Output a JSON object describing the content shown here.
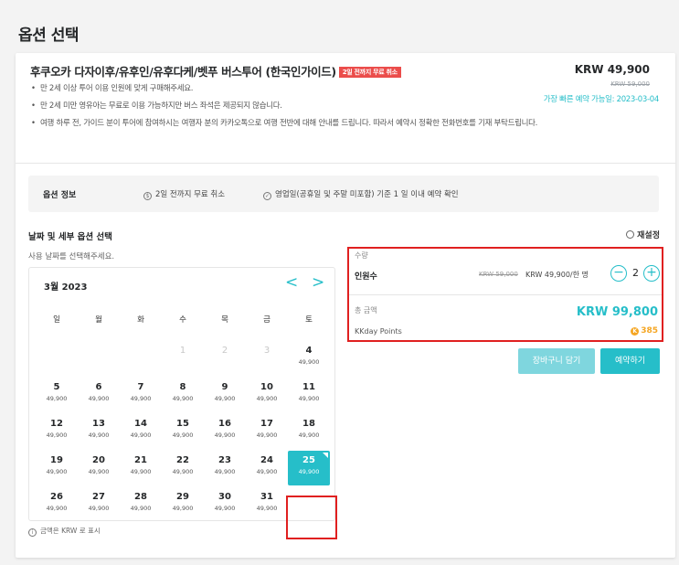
{
  "page": {
    "title": "옵션 선택"
  },
  "product": {
    "title": "후쿠오카 다자이후/유후인/유후다케/벳푸 버스투어 (한국인가이드)",
    "badge": "2일 전까지 무료 취소",
    "price": "KRW 49,900",
    "old_price": "KRW 59,000",
    "availability": "가장 빠른 예약 가능일: 2023-03-04",
    "notes": [
      "만 2세 이상 투어 이용 인원에 맞게 구매해주세요.",
      "만 2세 미만 영유아는 무료로 이용 가능하지만 버스 좌석은 제공되지 않습니다.",
      "여행 하루 전, 가이드 분이 투어에 참여하시는 여행자 분의 카카오톡으로 여행 전반에 대해 안내를 드립니다. 따라서 예약시 정확한 전화번호를 기재 부탁드립니다."
    ]
  },
  "option_info": {
    "label": "옵션 정보",
    "cancel": "2일 전까지 무료 취소",
    "confirm": "영업일(공휴일 및 주말 미포함) 기준 1 일 이내 예약 확인"
  },
  "date_section": {
    "title": "날짜 및 세부 옵션 선택",
    "subtitle": "사용 날짜를 선택해주세요.",
    "reset": "재설정",
    "footnote": "금액은 KRW 로 표시"
  },
  "calendar": {
    "month": "3월 2023",
    "prev": "<",
    "next": ">",
    "weekdays": [
      "일",
      "월",
      "화",
      "수",
      "목",
      "금",
      "토"
    ],
    "selected_day": "25",
    "days": [
      {
        "n": "1",
        "p": ""
      },
      {
        "n": "2",
        "p": ""
      },
      {
        "n": "3",
        "p": ""
      },
      {
        "n": "4",
        "p": "49,900"
      },
      {
        "n": "5",
        "p": "49,900"
      },
      {
        "n": "6",
        "p": "49,900"
      },
      {
        "n": "7",
        "p": "49,900"
      },
      {
        "n": "8",
        "p": "49,900"
      },
      {
        "n": "9",
        "p": "49,900"
      },
      {
        "n": "10",
        "p": "49,900"
      },
      {
        "n": "11",
        "p": "49,900"
      },
      {
        "n": "12",
        "p": "49,900"
      },
      {
        "n": "13",
        "p": "49,900"
      },
      {
        "n": "14",
        "p": "49,900"
      },
      {
        "n": "15",
        "p": "49,900"
      },
      {
        "n": "16",
        "p": "49,900"
      },
      {
        "n": "17",
        "p": "49,900"
      },
      {
        "n": "18",
        "p": "49,900"
      },
      {
        "n": "19",
        "p": "49,900"
      },
      {
        "n": "20",
        "p": "49,900"
      },
      {
        "n": "21",
        "p": "49,900"
      },
      {
        "n": "22",
        "p": "49,900"
      },
      {
        "n": "23",
        "p": "49,900"
      },
      {
        "n": "24",
        "p": "49,900"
      },
      {
        "n": "25",
        "p": "49,900"
      },
      {
        "n": "26",
        "p": "49,900"
      },
      {
        "n": "27",
        "p": "49,900"
      },
      {
        "n": "28",
        "p": "49,900"
      },
      {
        "n": "29",
        "p": "49,900"
      },
      {
        "n": "30",
        "p": "49,900"
      },
      {
        "n": "31",
        "p": "49,900"
      }
    ]
  },
  "quantity": {
    "label": "수량",
    "item": "인원수",
    "old_price": "KRW 59,000",
    "unit_price": "KRW 49,900/한 명",
    "value": "2",
    "minus": "−",
    "plus": "+",
    "total_label": "총 금액",
    "total": "KRW 99,800",
    "points_label": "KKday Points",
    "points": "385",
    "coin_glyph": "K"
  },
  "buttons": {
    "cart": "장바구니 담기",
    "book": "예약하기"
  },
  "colors": {
    "accent": "#26bec9",
    "highlight": "#e02020",
    "badge": "#eb4d4b",
    "points": "#f5a623"
  }
}
